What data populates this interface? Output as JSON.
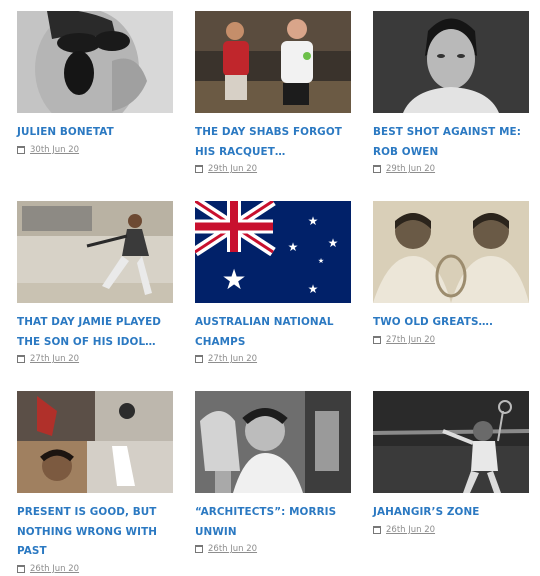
{
  "posts": [
    {
      "title": "JULIEN BONETAT",
      "date": "30th Jun 20",
      "image": "man shouting with sunglasses (b&w)"
    },
    {
      "title": "THE DAY SHABS FORGOT HIS RACQUET…",
      "date": "29th Jun 20",
      "image": "two squash players on court"
    },
    {
      "title": "BEST SHOT AGAINST ME: ROB OWEN",
      "date": "29th Jun 20",
      "image": "portrait of young man (b&w)"
    },
    {
      "title": "THAT DAY JAMIE PLAYED THE SON OF HIS IDOL…",
      "date": "27th Jun 20",
      "image": "squash player lunging"
    },
    {
      "title": "AUSTRALIAN NATIONAL CHAMPS",
      "date": "27th Jun 20",
      "image": "australian flag"
    },
    {
      "title": "TWO OLD GREATS….",
      "date": "27th Jun 20",
      "image": "two men with trophy (sepia)"
    },
    {
      "title": "PRESENT IS GOOD, BUT NOTHING WRONG WITH PAST",
      "date": "26th Jun 20",
      "image": "collage of squash players"
    },
    {
      "title": "“ARCHITECTS”: MORRIS UNWIN",
      "date": "26th Jun 20",
      "image": "man holding trophy (b&w)"
    },
    {
      "title": "JAHANGIR’S ZONE",
      "date": "26th Jun 20",
      "image": "squash player swinging (b&w)"
    }
  ],
  "colors": {
    "title": "#2b79c2",
    "date": "#8e8e8e"
  },
  "icons": {
    "date": "calendar-icon"
  }
}
